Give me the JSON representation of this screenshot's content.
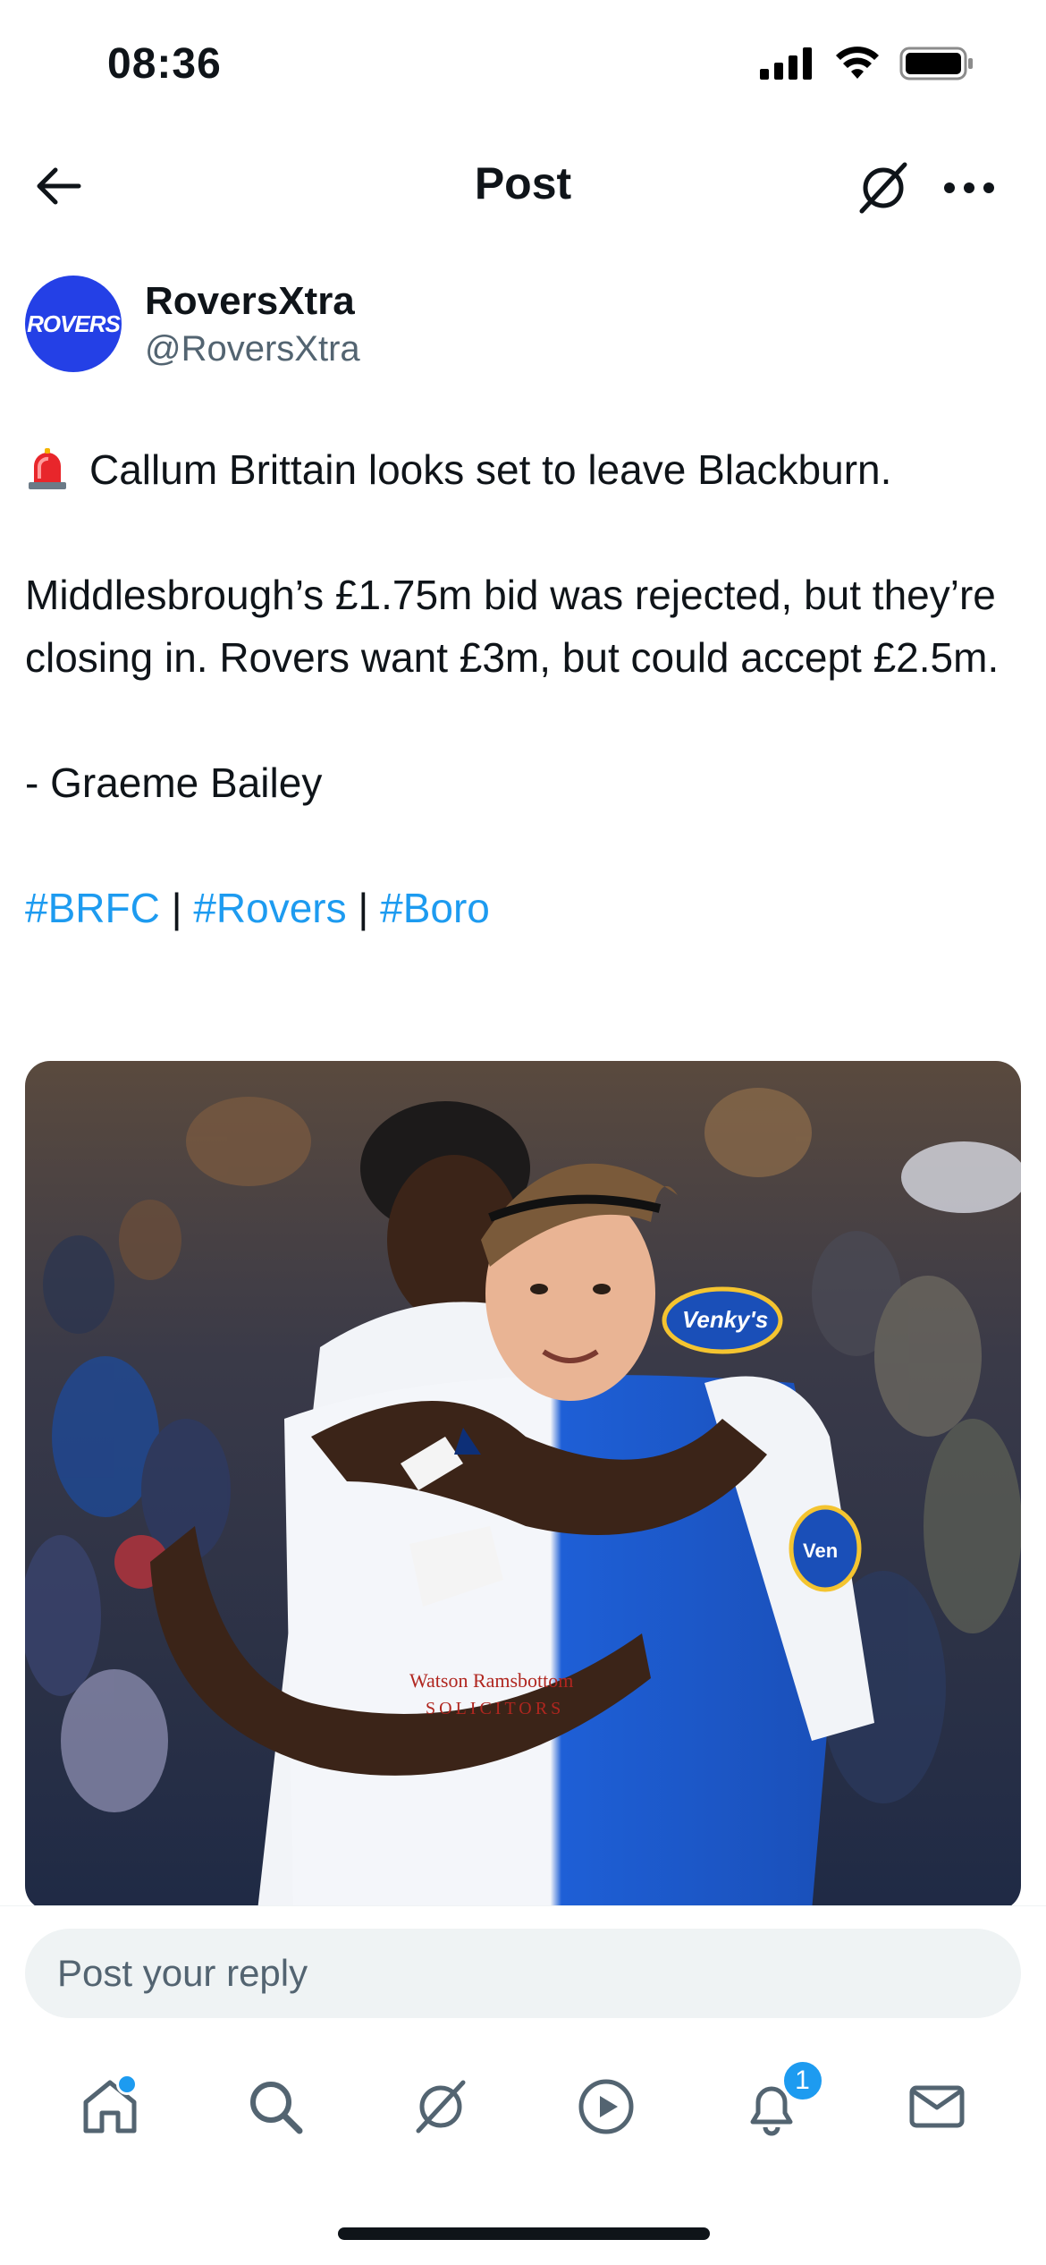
{
  "status_bar": {
    "time": "08:36"
  },
  "header": {
    "title": "Post"
  },
  "author": {
    "name": "RoversXtra",
    "handle": "@RoversXtra",
    "avatar_text": "ROVERS"
  },
  "post": {
    "line1": "Callum Brittain looks set to leave Blackburn.",
    "para2": "Middlesbrough’s £1.75m bid was rejected, but they’re closing in. Rovers want £3m, but could accept £2.5m.",
    "para3": "- Graeme Bailey",
    "hashtags": [
      "#BRFC",
      "#Rovers",
      "#Boro"
    ],
    "separator": "|",
    "shirt_sponsor": "Watson Ramsbottom SOLICITORS",
    "sleeve_sponsor": "Venky's"
  },
  "reply": {
    "placeholder": "Post your reply"
  },
  "tabs": [
    {
      "name": "home-icon"
    },
    {
      "name": "search-icon"
    },
    {
      "name": "grok-icon"
    },
    {
      "name": "video-icon"
    },
    {
      "name": "notifications-icon",
      "badge": "1"
    },
    {
      "name": "messages-icon"
    }
  ],
  "colors": {
    "accent": "#1d9bf0",
    "avatar_bg": "#2440e6",
    "text": "#0f1419",
    "muted": "#536471"
  }
}
